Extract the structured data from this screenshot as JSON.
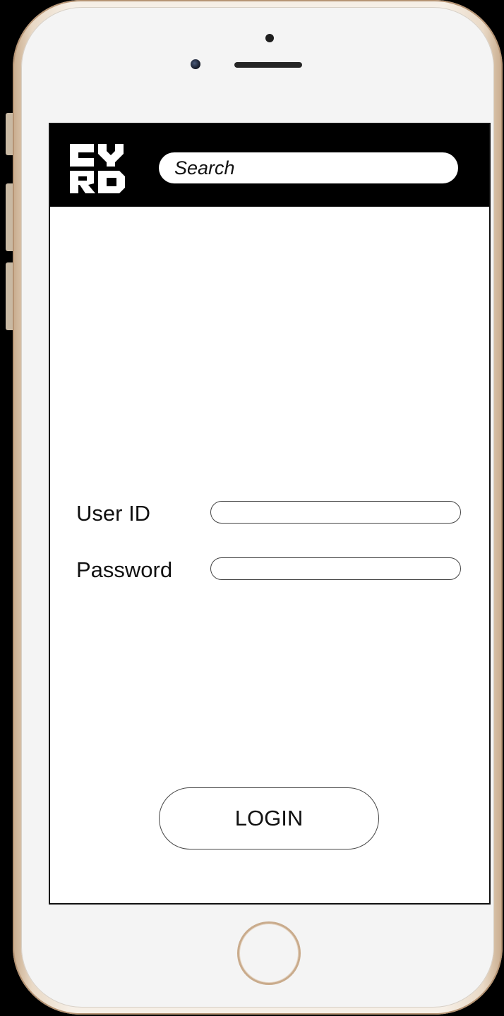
{
  "header": {
    "logo_text": "CY RO",
    "search_placeholder": "Search"
  },
  "form": {
    "user_id_label": "User ID",
    "user_id_value": "",
    "password_label": "Password",
    "password_value": ""
  },
  "actions": {
    "login_label": "LOGIN"
  },
  "icons": {
    "logo": "cyro-logo-icon",
    "home": "home-button-icon",
    "camera": "front-camera-icon",
    "speaker": "speaker-icon"
  },
  "colors": {
    "header_background": "#000000",
    "screen_background": "#ffffff",
    "phone_body": "#f4f4f4",
    "phone_trim": "#c8ab8c"
  }
}
